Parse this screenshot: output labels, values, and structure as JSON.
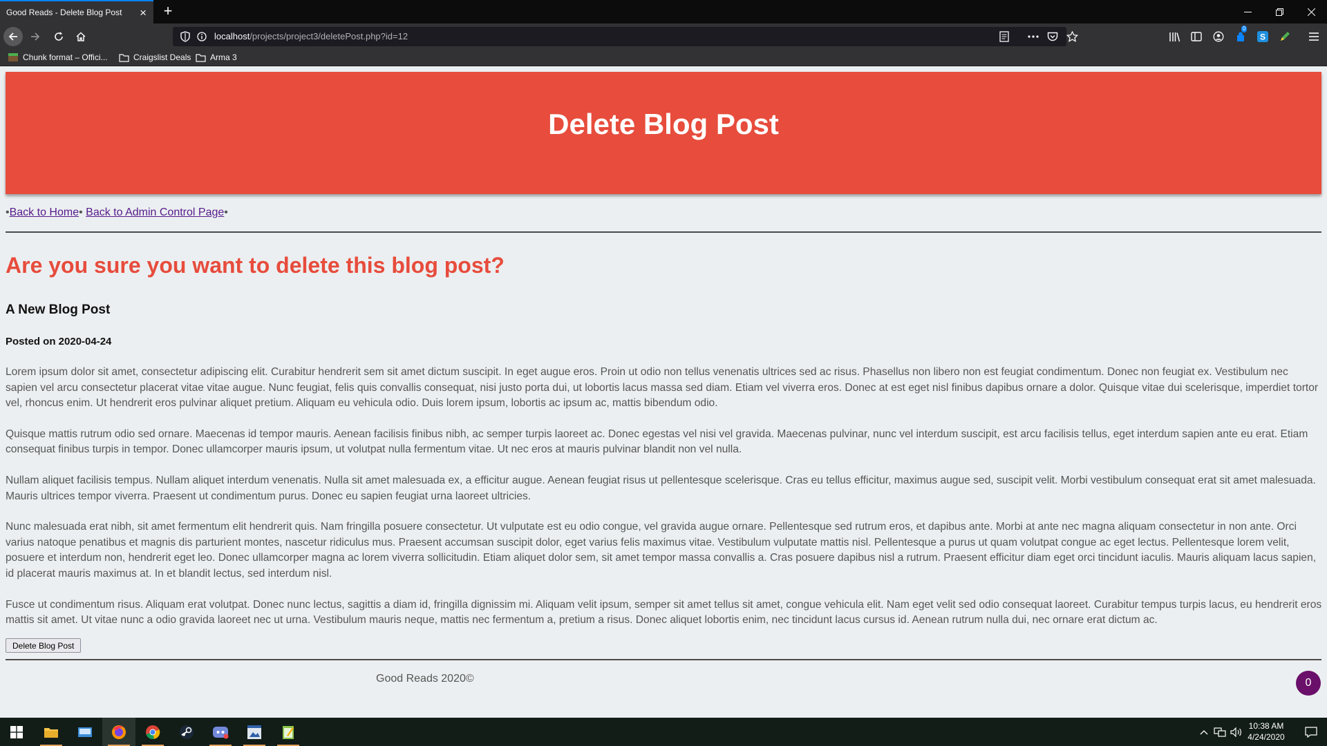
{
  "browser": {
    "tab_title": "Good Reads - Delete Blog Post",
    "url_host": "localhost",
    "url_path": "/projects/project3/deletePost.php?id=12",
    "bookmarks": [
      "Chunk format – Offici...",
      "Craigslist Deals",
      "Arma 3"
    ],
    "notification_badge": "0"
  },
  "header": {
    "title": "Delete Blog Post"
  },
  "nav": {
    "separator": "•",
    "home_link": "Back to Home",
    "admin_link": "Back to Admin Control Page"
  },
  "confirm": {
    "question": "Are you sure you want to delete this blog post?"
  },
  "post": {
    "title": "A New Blog Post",
    "date": "Posted on 2020-04-24",
    "paragraphs": [
      "Lorem ipsum dolor sit amet, consectetur adipiscing elit. Curabitur hendrerit sem sit amet dictum suscipit. In eget augue eros. Proin ut odio non tellus venenatis ultrices sed ac risus. Phasellus non libero non est feugiat condimentum. Donec non feugiat ex. Vestibulum nec sapien vel arcu consectetur placerat vitae vitae augue. Nunc feugiat, felis quis convallis consequat, nisi justo porta dui, ut lobortis lacus massa sed diam. Etiam vel viverra eros. Donec at est eget nisl finibus dapibus ornare a dolor. Quisque vitae dui scelerisque, imperdiet tortor vel, rhoncus enim. Ut hendrerit eros pulvinar aliquet pretium. Aliquam eu vehicula odio. Duis lorem ipsum, lobortis ac ipsum ac, mattis bibendum odio.",
      "Quisque mattis rutrum odio sed ornare. Maecenas id tempor mauris. Aenean facilisis finibus nibh, ac semper turpis laoreet ac. Donec egestas vel nisi vel gravida. Maecenas pulvinar, nunc vel interdum suscipit, est arcu facilisis tellus, eget interdum sapien ante eu erat. Etiam consequat finibus turpis in tempor. Donec ullamcorper mauris ipsum, ut volutpat nulla fermentum vitae. Ut nec eros at mauris pulvinar blandit non vel nulla.",
      "Nullam aliquet facilisis tempus. Nullam aliquet interdum venenatis. Nulla sit amet malesuada ex, a efficitur augue. Aenean feugiat risus ut pellentesque scelerisque. Cras eu tellus efficitur, maximus augue sed, suscipit velit. Morbi vestibulum consequat erat sit amet malesuada. Mauris ultrices tempor viverra. Praesent ut condimentum purus. Donec eu sapien feugiat urna laoreet ultricies.",
      "Nunc malesuada erat nibh, sit amet fermentum elit hendrerit quis. Nam fringilla posuere consectetur. Ut vulputate est eu odio congue, vel gravida augue ornare. Pellentesque sed rutrum eros, et dapibus ante. Morbi at ante nec magna aliquam consectetur in non ante. Orci varius natoque penatibus et magnis dis parturient montes, nascetur ridiculus mus. Praesent accumsan suscipit dolor, eget varius felis maximus vitae. Vestibulum vulputate mattis nisl. Pellentesque a purus ut quam volutpat congue ac eget lectus. Pellentesque lorem velit, posuere et interdum non, hendrerit eget leo. Donec ullamcorper magna ac lorem viverra sollicitudin. Etiam aliquet dolor sem, sit amet tempor massa convallis a. Cras posuere dapibus nisl a rutrum. Praesent efficitur diam eget orci tincidunt iaculis. Mauris aliquam lacus sapien, id placerat mauris maximus at. In et blandit lectus, sed interdum nisl.",
      "Fusce ut condimentum risus. Aliquam erat volutpat. Donec nunc lectus, sagittis a diam id, fringilla dignissim mi. Aliquam velit ipsum, semper sit amet tellus sit amet, congue vehicula elit. Nam eget velit sed odio consequat laoreet. Curabitur tempus turpis lacus, eu hendrerit eros mattis sit amet. Ut vitae nunc a odio gravida laoreet nec ut urna. Vestibulum mauris neque, mattis nec fermentum a, pretium a risus. Donec aliquet lobortis enim, nec tincidunt lacus cursus id. Aenean rutrum nulla dui, nec ornare erat dictum ac."
    ]
  },
  "actions": {
    "delete_label": "Delete Blog Post"
  },
  "footer": {
    "copyright": "Good Reads 2020©",
    "counter": "0"
  },
  "taskbar": {
    "time": "10:38 AM",
    "date": "4/24/2020"
  },
  "colors": {
    "accent": "#e74c3c",
    "link_visited": "#551a8b",
    "body_text": "#555555",
    "page_background": "#eceff1",
    "counter_badge": "#6a0f6a"
  },
  "icons": {
    "browser": [
      "back-arrow-icon",
      "forward-arrow-icon",
      "reload-icon",
      "home-icon",
      "shield-icon",
      "info-icon",
      "reader-view-icon",
      "more-actions-icon",
      "pocket-icon",
      "bookmark-star-icon",
      "library-icon",
      "sidebar-icon",
      "account-icon",
      "extension-icon",
      "skype-icon",
      "pen-icon",
      "menu-icon"
    ],
    "taskbar": [
      "windows-start-icon",
      "file-explorer-icon",
      "control-panel-icon",
      "firefox-icon",
      "chrome-icon",
      "steam-icon",
      "discord-icon",
      "image-editor-icon",
      "notepad-icon",
      "show-hidden-icons-icon",
      "network-icon",
      "volume-icon",
      "notifications-icon"
    ]
  }
}
